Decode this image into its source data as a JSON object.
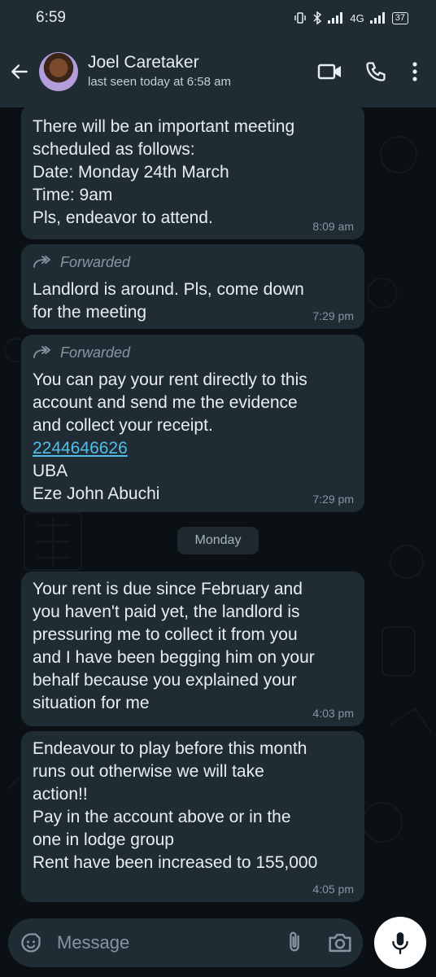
{
  "status_bar": {
    "time": "6:59",
    "network": "4G",
    "battery": "37"
  },
  "header": {
    "contact_name": "Joel Caretaker",
    "last_seen": "last seen today at 6:58 am",
    "icons": [
      "back-arrow-icon",
      "video-call-icon",
      "voice-call-icon",
      "more-options-icon"
    ]
  },
  "messages": [
    {
      "text": "There will be an important meeting\nscheduled as follows:\nDate: Monday 24th March\nTime: 9am\nPls, endeavor to attend.",
      "time": "8:09 am",
      "forwarded": false
    },
    {
      "forwarded_label": "Forwarded",
      "text": "Landlord is around. Pls, come down\nfor the meeting",
      "time": "7:29 pm",
      "forwarded": true
    },
    {
      "forwarded_label": "Forwarded",
      "text": "You can pay your rent directly to this\naccount and send me the evidence\nand collect your receipt.",
      "account_number": "2244646626",
      "bank": "UBA",
      "account_name": "Eze John Abuchi",
      "time": "7:29 pm",
      "forwarded": true
    },
    {
      "text": "Your rent is due since February and\nyou haven't paid yet, the landlord is\npressuring me to collect it from you\nand I have been begging him on your\nbehalf because you explained your\nsituation for me",
      "time": "4:03 pm",
      "forwarded": false
    },
    {
      "text": "Endeavour to play before this month\nruns out otherwise we will take\naction!!\nPay in the account above or in the\none in lodge group\nRent have been increased to 155,000",
      "time": "4:05 pm",
      "forwarded": false
    }
  ],
  "day_separator": "Monday",
  "composer": {
    "placeholder": "Message",
    "icons": [
      "emoji-icon",
      "attach-icon",
      "camera-icon",
      "mic-icon"
    ]
  },
  "colors": {
    "header_bg": "#1f2c34",
    "bubble_bg": "#202c33",
    "link": "#53bdeb",
    "meta_text": "#8696a0"
  }
}
